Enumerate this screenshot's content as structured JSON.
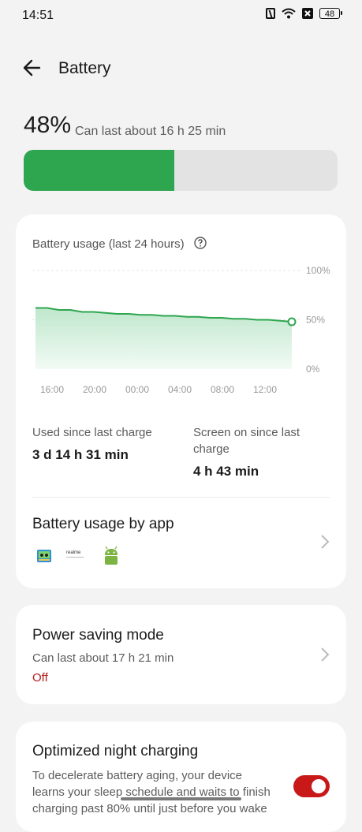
{
  "status_bar": {
    "time": "14:51",
    "battery_level": "48",
    "icons": [
      "nfc-icon",
      "wifi-icon",
      "close-box-icon",
      "battery-icon"
    ]
  },
  "header": {
    "title": "Battery",
    "back_icon": "arrow-left-icon"
  },
  "battery": {
    "percent": "48%",
    "percent_value": 48,
    "estimate": "Can last about 16 h 25 min",
    "fill_color": "#2ea54f"
  },
  "usage_card": {
    "title": "Battery usage (last 24 hours)",
    "help_icon": "question-circle-icon",
    "stats": {
      "used_label": "Used since last charge",
      "used_value": "3 d 14 h 31 min",
      "screen_label_line1": "Screen on since last",
      "screen_label_line2": "charge",
      "screen_value": "4 h 43 min"
    },
    "by_app": {
      "title": "Battery usage by app",
      "app_icons": [
        "tablet-app-icon",
        "realme-app-icon",
        "android-icon"
      ],
      "realme_text": "realme"
    }
  },
  "chart_data": {
    "type": "area",
    "title": "Battery usage (last 24 hours)",
    "x_ticks": [
      "16:00",
      "20:00",
      "00:00",
      "04:00",
      "08:00",
      "12:00"
    ],
    "y_ticks": [
      "100%",
      "50%",
      "0%"
    ],
    "ylim": [
      0,
      100
    ],
    "unit": "%",
    "series": [
      {
        "values": [
          62,
          62,
          60,
          60,
          58,
          58,
          57,
          56,
          56,
          55,
          55,
          54,
          54,
          53,
          53,
          52,
          52,
          51,
          51,
          50,
          50,
          49,
          48
        ],
        "color": "#2ea54f"
      }
    ],
    "grid": true
  },
  "power_saving": {
    "title": "Power saving mode",
    "subtitle": "Can last about 17 h 21 min",
    "status": "Off"
  },
  "night_charging": {
    "title": "Optimized night charging",
    "description_line1": "To decelerate battery aging, your device",
    "description_line2": "learns your sleep schedule and waits to finish",
    "description_line3": "charging past 80% until just before you wake",
    "enabled": true,
    "toggle_color": "#c81818"
  }
}
